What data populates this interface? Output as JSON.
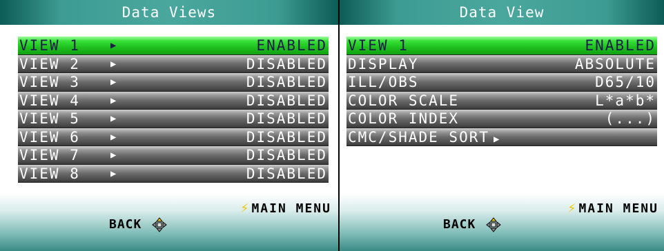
{
  "left_panel": {
    "title": "Data Views",
    "rows": [
      {
        "label": "VIEW 1",
        "value": "ENABLED",
        "arrow": "▶"
      },
      {
        "label": "VIEW 2",
        "value": "DISABLED",
        "arrow": "▶"
      },
      {
        "label": "VIEW 3",
        "value": "DISABLED",
        "arrow": "▶"
      },
      {
        "label": "VIEW 4",
        "value": "DISABLED",
        "arrow": "▶"
      },
      {
        "label": "VIEW 5",
        "value": "DISABLED",
        "arrow": "▶"
      },
      {
        "label": "VIEW 6",
        "value": "DISABLED",
        "arrow": "▶"
      },
      {
        "label": "VIEW 7",
        "value": "DISABLED",
        "arrow": "▶"
      },
      {
        "label": "VIEW 8",
        "value": "DISABLED",
        "arrow": "▶"
      }
    ],
    "footer": {
      "main_menu": "MAIN MENU",
      "back": "BACK"
    }
  },
  "right_panel": {
    "title": "Data View",
    "rows": [
      {
        "label": "VIEW 1",
        "value": "ENABLED"
      },
      {
        "label": "DISPLAY",
        "value": "ABSOLUTE"
      },
      {
        "label": "ILL/OBS",
        "value": "D65/10"
      },
      {
        "label": "COLOR SCALE",
        "value": "L*a*b*"
      },
      {
        "label": "COLOR INDEX",
        "value": "(...)"
      },
      {
        "label": "CMC/SHADE SORT",
        "arrow": "▶"
      }
    ],
    "footer": {
      "main_menu": "MAIN MENU",
      "back": "BACK"
    }
  },
  "icons": {
    "main_menu": "lightning-bolt-icon",
    "back": "dpad-icon"
  },
  "colors": {
    "title_bar": "#3c9c93",
    "selected_row": "#1fc01f",
    "selected_text": "#1e1b4d",
    "row_gray": "#6b6b6b",
    "bolt": "#f2c500"
  }
}
